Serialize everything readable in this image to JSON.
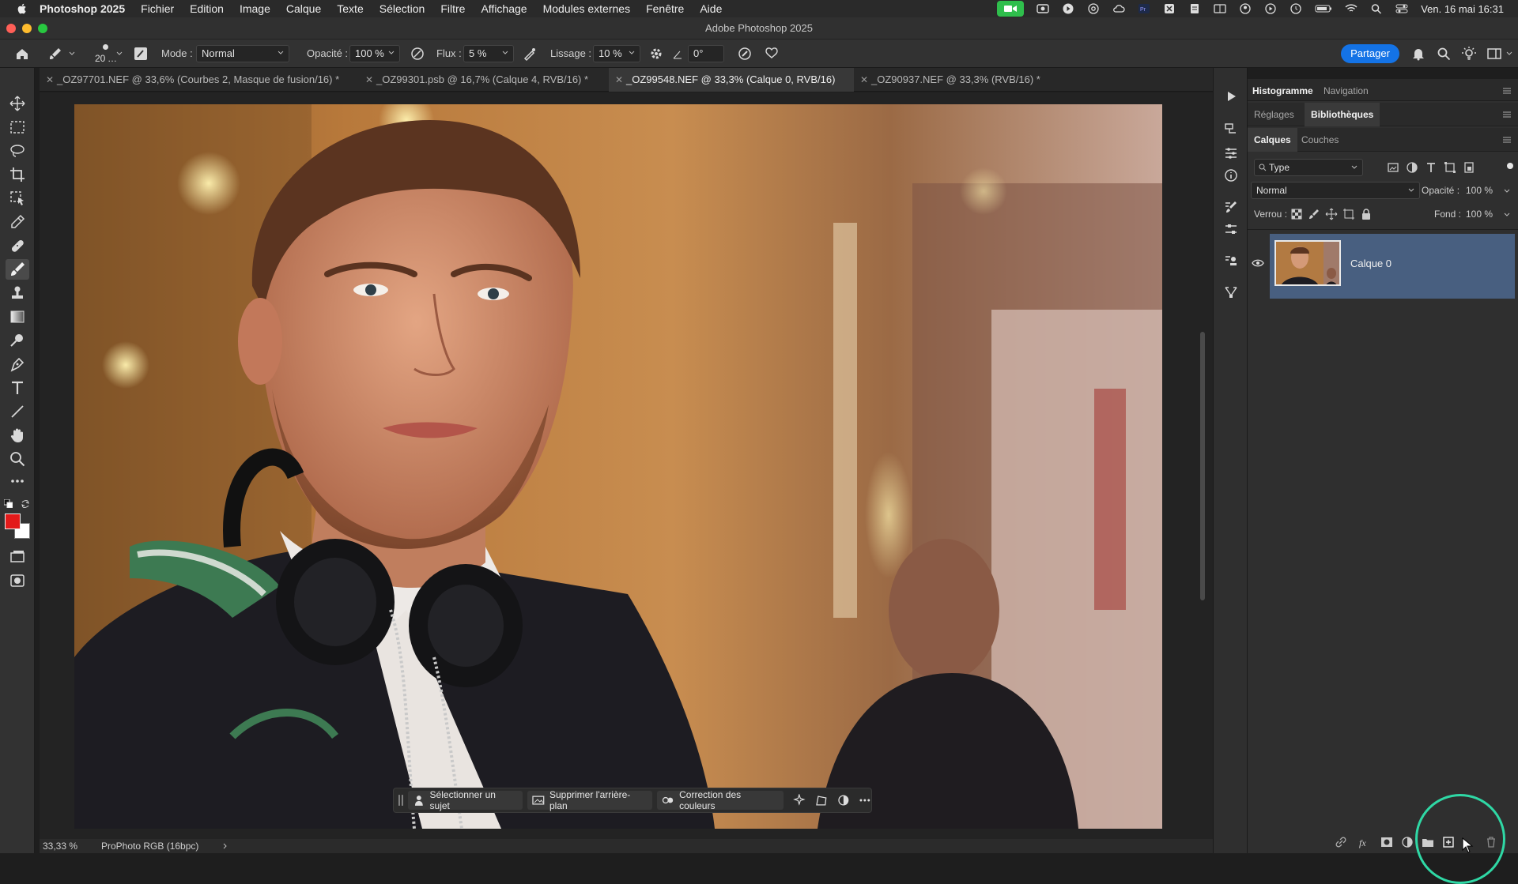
{
  "menubar": {
    "app_name": "Photoshop 2025",
    "items": [
      "Fichier",
      "Edition",
      "Image",
      "Calque",
      "Texte",
      "Sélection",
      "Filtre",
      "Affichage",
      "Modules externes",
      "Fenêtre",
      "Aide"
    ],
    "datetime": "Ven. 16 mai  16:31"
  },
  "window": {
    "title": "Adobe Photoshop 2025"
  },
  "options": {
    "brush_size": "20",
    "mode_label": "Mode :",
    "mode_value": "Normal",
    "opacity_label": "Opacité :",
    "opacity_value": "100 %",
    "flow_label": "Flux :",
    "flow_value": "5 %",
    "smoothing_label": "Lissage :",
    "smoothing_value": "10 %",
    "angle_value": "0°",
    "share_label": "Partager"
  },
  "tabs": [
    {
      "label": "_OZ97701.NEF @ 33,6% (Courbes 2, Masque de fusion/16) *",
      "active": false
    },
    {
      "label": "_OZ99301.psb @ 16,7% (Calque 4, RVB/16) *",
      "active": false
    },
    {
      "label": "_OZ99548.NEF @ 33,3% (Calque 0, RVB/16)",
      "active": true
    },
    {
      "label": "_OZ90937.NEF @ 33,3% (RVB/16) *",
      "active": false
    }
  ],
  "colors": {
    "foreground": "#e31a1a",
    "background": "#ffffff",
    "accent": "#1473e6",
    "layer_selected": "#485f80",
    "highlight_ring": "#2fd8a5"
  },
  "taskbar": {
    "select_subject": "Sélectionner un sujet",
    "remove_background": "Supprimer l'arrière-plan",
    "color_correction": "Correction des couleurs"
  },
  "status": {
    "zoom": "33,33 %",
    "profile": "ProPhoto RGB (16bpc)"
  },
  "panels": {
    "row1": {
      "histogram": "Histogramme",
      "navigation": "Navigation"
    },
    "row2": {
      "adjustments": "Réglages",
      "libraries": "Bibliothèques"
    },
    "row3": {
      "layers": "Calques",
      "channels": "Couches"
    },
    "filter_kind": "Type",
    "blend_mode": "Normal",
    "opacity_label": "Opacité :",
    "opacity_value": "100 %",
    "lock_label": "Verrou :",
    "fill_label": "Fond :",
    "fill_value": "100 %",
    "layer_name": "Calque 0"
  }
}
